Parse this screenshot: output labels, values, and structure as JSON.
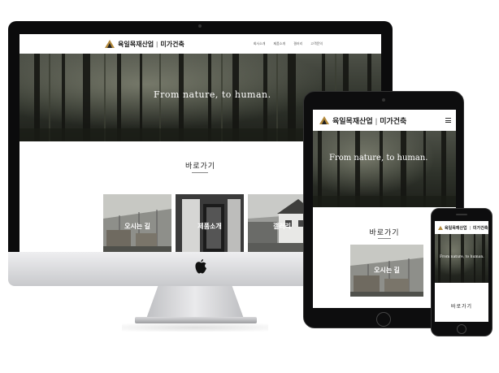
{
  "site": {
    "brand": "육일목재산업",
    "brand_sub": "미가건축",
    "tagline": "From nature, to human.",
    "nav": [
      "회사소개",
      "제품소개",
      "갤러리",
      "고객문의"
    ],
    "section_title": "바로가기",
    "thumbs": [
      {
        "label": "오시는 길"
      },
      {
        "label": "제품소개"
      },
      {
        "label": "갤러리"
      }
    ]
  },
  "colors": {
    "accent": "#b48a3c",
    "hero_dark": "#2e3128",
    "device_black": "#0b0b0c"
  },
  "icons": {
    "logo": "triangle-logo-icon",
    "menu": "hamburger-icon",
    "apple": "apple-logo-icon"
  }
}
